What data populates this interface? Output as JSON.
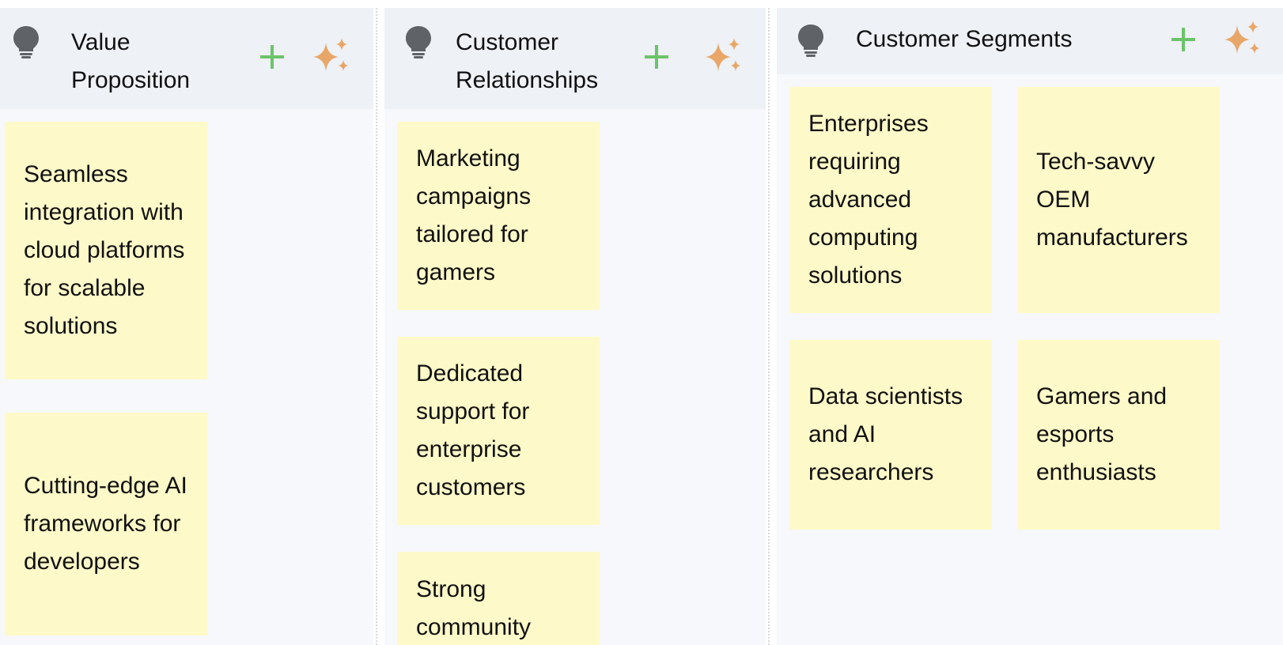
{
  "columns": {
    "value_proposition": {
      "title": "Value Proposition",
      "icon": "lightbulb-icon",
      "notes": [
        "Seamless integration with cloud platforms for scalable solutions",
        "Cutting-edge AI frameworks for developers"
      ]
    },
    "customer_relationships": {
      "title": "Customer Relationships",
      "icon": "lightbulb-icon",
      "notes": [
        "Marketing campaigns tailored for gamers",
        "Dedicated support for enterprise customers",
        "Strong community"
      ]
    },
    "customer_segments": {
      "title": "Customer Segments",
      "icon": "lightbulb-icon",
      "notes": [
        "Enterprises requiring advanced computing solutions",
        "Tech-savvy OEM manufacturers",
        "Data scientists and AI researchers",
        "Gamers and esports enthusiasts"
      ]
    }
  },
  "icons": {
    "add": "plus-icon",
    "ai": "sparkles-icon",
    "column": "lightbulb-icon"
  },
  "colors": {
    "note_background": "#fef9c8",
    "header_background": "#eef1f6",
    "column_background": "#f7f8fb",
    "add_icon": "#6cc46a",
    "sparkle_icon": "#e8a768",
    "bulb_icon": "#5f6368"
  }
}
